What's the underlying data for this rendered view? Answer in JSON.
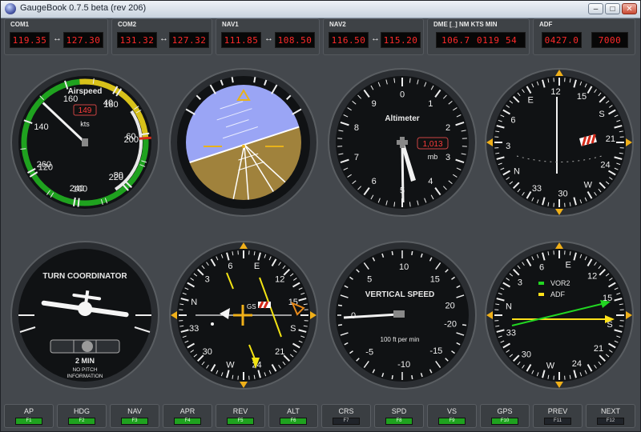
{
  "window": {
    "title": "GaugeBook 0.7.5 beta (rev 206)",
    "min_glyph": "–",
    "max_glyph": "□",
    "close_glyph": "✕"
  },
  "radios": {
    "com1": {
      "label": "COM1",
      "active": "119.35",
      "standby": "127.30",
      "swap": "↔"
    },
    "com2": {
      "label": "COM2",
      "active": "131.32",
      "standby": "127.32",
      "swap": "↔"
    },
    "nav1": {
      "label": "NAV1",
      "active": "111.85",
      "standby": "108.50",
      "swap": "↔"
    },
    "nav2": {
      "label": "NAV2",
      "active": "116.50",
      "standby": "115.20",
      "swap": "↔"
    },
    "dme": {
      "label": "DME [_] NM KTS MIN",
      "distance": "106.7",
      "speed": "0119",
      "time": "54"
    },
    "adf": {
      "label": "ADF",
      "active": "0427.0",
      "standby": "7000"
    }
  },
  "airspeed": {
    "title": "Airspeed",
    "units": "kts",
    "readout": "149",
    "ticks": [
      "40",
      "60",
      "80",
      "100",
      "120",
      "140",
      "160",
      "180",
      "200",
      "220",
      "240",
      "260"
    ],
    "value_kts": 149
  },
  "attitude": {
    "pitch_deg": 3,
    "bank_deg": -18
  },
  "altimeter": {
    "title": "Altimeter",
    "pressure": "1,013",
    "pressure_units": "mb",
    "ticks": [
      "0",
      "1",
      "2",
      "3",
      "4",
      "5",
      "6",
      "7",
      "8",
      "9"
    ]
  },
  "heading": {
    "labels": [
      "N",
      "3",
      "6",
      "E",
      "12",
      "15",
      "S",
      "21",
      "24",
      "W",
      "30",
      "33"
    ],
    "heading_deg": 124
  },
  "turn": {
    "title": "TURN COORDINATOR",
    "note1": "2 MIN",
    "note2": "NO PITCH",
    "note3": "INFORMATION"
  },
  "hsi": {
    "labels": [
      "N",
      "3",
      "6",
      "E",
      "12",
      "15",
      "S",
      "21",
      "24",
      "W",
      "30",
      "33"
    ],
    "gs_label": "GS"
  },
  "vsi": {
    "title": "VERTICAL SPEED",
    "units": "100 ft per min",
    "ticks": [
      "0",
      "5",
      "10",
      "15",
      "20",
      "-20",
      "-15",
      "-10",
      "-5"
    ],
    "value": 0
  },
  "rmi": {
    "labels": [
      "N",
      "3",
      "6",
      "E",
      "12",
      "15",
      "S",
      "21",
      "24",
      "W",
      "30",
      "33"
    ],
    "legend": [
      {
        "name": "VOR2",
        "color": "#22d622"
      },
      {
        "name": "ADF",
        "color": "#ffe11a"
      }
    ]
  },
  "fkeys": [
    {
      "label": "AP",
      "key": "F1",
      "on": true
    },
    {
      "label": "HDG",
      "key": "F2",
      "on": true
    },
    {
      "label": "NAV",
      "key": "F3",
      "on": true
    },
    {
      "label": "APR",
      "key": "F4",
      "on": true
    },
    {
      "label": "REV",
      "key": "F5",
      "on": true
    },
    {
      "label": "ALT",
      "key": "F6",
      "on": true
    },
    {
      "label": "CRS",
      "key": "F7",
      "on": false
    },
    {
      "label": "SPD",
      "key": "F8",
      "on": true
    },
    {
      "label": "VS",
      "key": "F9",
      "on": true
    },
    {
      "label": "GPS",
      "key": "F10",
      "on": true
    },
    {
      "label": "PREV",
      "key": "F11",
      "on": false
    },
    {
      "label": "NEXT",
      "key": "F12",
      "on": false
    }
  ]
}
